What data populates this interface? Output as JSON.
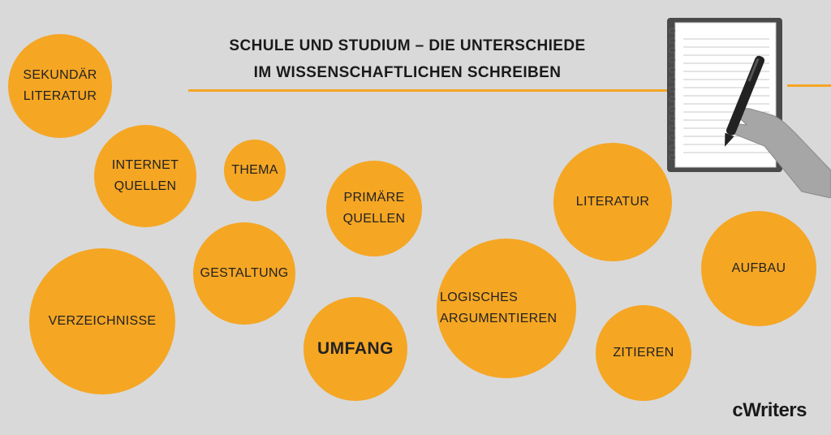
{
  "title": {
    "line1": "SCHULE UND STUDIUM – DIE UNTERSCHIEDE",
    "line2": "IM WISSENSCHAFTLICHEN SCHREIBEN"
  },
  "bubbles": {
    "sekundaer": [
      "SEKUNDÄR",
      "LITERATUR"
    ],
    "internet": [
      "INTERNET",
      "QUELLEN"
    ],
    "thema": [
      "THEMA"
    ],
    "primaere": [
      "PRIMÄRE",
      "QUELLEN"
    ],
    "literatur": [
      "LITERATUR"
    ],
    "aufbau": [
      "AUFBAU"
    ],
    "gestaltung": [
      "GESTALTUNG"
    ],
    "verzeichnisse": [
      "VERZEICHNISSE"
    ],
    "umfang": [
      "UMFANG"
    ],
    "logisches": [
      "LOGISCHES",
      "ARGUMENTIEREN"
    ],
    "zitieren": [
      "ZITIEREN"
    ]
  },
  "logo": "cWriters",
  "colors": {
    "accent": "#f5a623",
    "background": "#d9d9d9",
    "text": "#1a1a1a"
  },
  "icons": {
    "illustration": "notepad-with-pen-hand-icon"
  }
}
